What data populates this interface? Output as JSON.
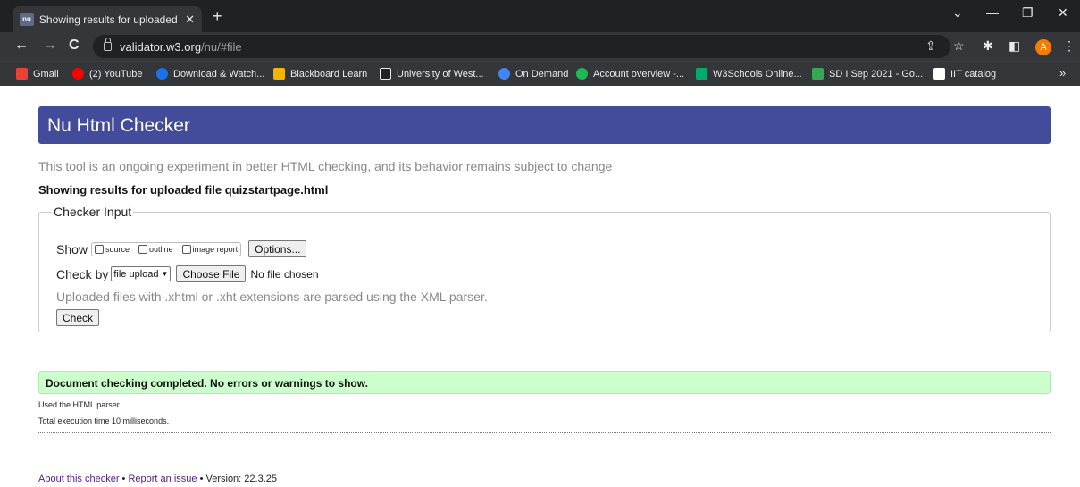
{
  "browser": {
    "tab_favicon_text": "nu",
    "tab_title": "Showing results for uploaded file quizstartpage.html",
    "url_host": "validator.w3.org",
    "url_path": "/nu/#file",
    "avatar_letter": "A",
    "bookmarks": [
      {
        "label": "Gmail",
        "color": "#ea4335"
      },
      {
        "label": "(2) YouTube",
        "color": "#ff0000"
      },
      {
        "label": "Download & Watch...",
        "color": "#1a73e8"
      },
      {
        "label": "Blackboard Learn",
        "color": "#f4b400"
      },
      {
        "label": "University of West...",
        "color": "#222222"
      },
      {
        "label": "On Demand",
        "color": "#4285f4"
      },
      {
        "label": "Account overview -...",
        "color": "#1db954"
      },
      {
        "label": "W3Schools Online...",
        "color": "#04aa6d"
      },
      {
        "label": "SD I Sep 2021 - Go...",
        "color": "#34a853"
      },
      {
        "label": "IIT catalog",
        "color": "#ffffff"
      }
    ]
  },
  "page": {
    "header_title": "Nu Html Checker",
    "tagline": "This tool is an ongoing experiment in better HTML checking, and its behavior remains subject to change",
    "results_heading": "Showing results for uploaded file quizstartpage.html",
    "checker_input": {
      "legend": "Checker Input",
      "show_label": "Show",
      "show_options": [
        "source",
        "outline",
        "image report"
      ],
      "options_button": "Options...",
      "check_by_label": "Check by",
      "check_by_value": "file upload",
      "choose_file_button": "Choose File",
      "no_file_text": "No file chosen",
      "parser_note": "Uploaded files with .xhtml or .xht extensions are parsed using the XML parser.",
      "check_button": "Check"
    },
    "result_message": "Document checking completed. No errors or warnings to show.",
    "parser_used": "Used the HTML parser.",
    "execution_time": "Total execution time 10 milliseconds.",
    "footer": {
      "about_link": "About this checker",
      "separator": " • ",
      "report_link": "Report an issue",
      "version_text": "Version: 22.3.25"
    }
  }
}
